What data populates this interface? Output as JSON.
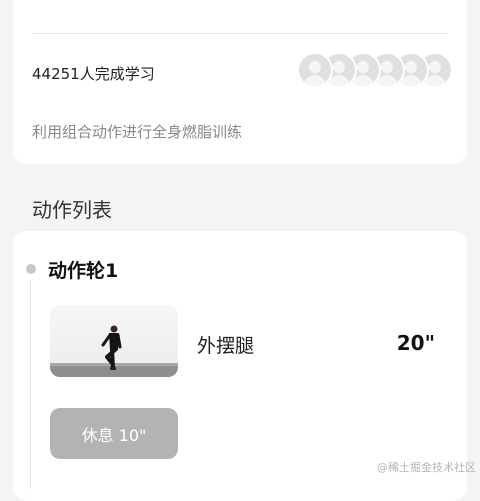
{
  "info_card": {
    "learners_text": "44251人完成学习",
    "description": "利用组合动作进行全身燃脂训练",
    "avatar_count": 6
  },
  "action_list": {
    "title": "动作列表",
    "rounds": [
      {
        "title": "动作轮1",
        "exercises": [
          {
            "name": "外摆腿",
            "duration": "20\""
          }
        ],
        "rest_label": "休息 10\""
      }
    ]
  },
  "watermark": "@稀土掘金技术社区",
  "colors": {
    "page_background": "#f4f4f4",
    "card_background": "#ffffff",
    "rest_button": "#b3b3b3",
    "timeline_dot": "#c7c7c7"
  }
}
